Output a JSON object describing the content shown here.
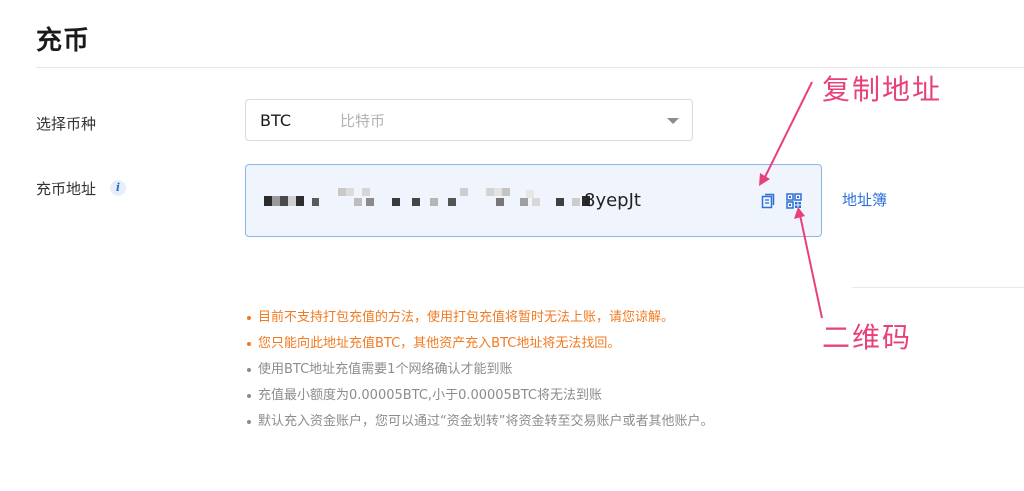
{
  "page": {
    "title": "充币"
  },
  "form": {
    "coin_label": "选择币种",
    "coin_selected_code": "BTC",
    "coin_selected_name": "比特币",
    "address_label": "充币地址",
    "address_info_icon": "i",
    "address_visible_suffix": "8yepJt",
    "address_book_link": "地址簿"
  },
  "icons": {
    "copy": "copy-icon",
    "qrcode": "qrcode-icon",
    "dropdown": "chevron-down-icon",
    "info": "info-icon"
  },
  "notes": [
    {
      "text": "目前不支持打包充值的方法，使用打包充值将暂时无法上账，请您谅解。",
      "level": "warning"
    },
    {
      "text": "您只能向此地址充值BTC，其他资产充入BTC地址将无法找回。",
      "level": "warning"
    },
    {
      "text": "使用BTC地址充值需要1个网络确认才能到账",
      "level": "info"
    },
    {
      "text": "充值最小额度为0.00005BTC,小于0.00005BTC将无法到账",
      "level": "info"
    },
    {
      "text": " 默认充入资金账户，您可以通过“资金划转”将资金转至交易账户或者其他账户。",
      "level": "info"
    }
  ],
  "annotations": {
    "copy_address": "复制地址",
    "qr_code": "二维码"
  },
  "colors": {
    "accent": "#2e6fd9",
    "warning": "#f07a22",
    "muted": "#8c8c8c",
    "annotation": "#e8407a",
    "address_box_bg": "#f0f5fd"
  }
}
